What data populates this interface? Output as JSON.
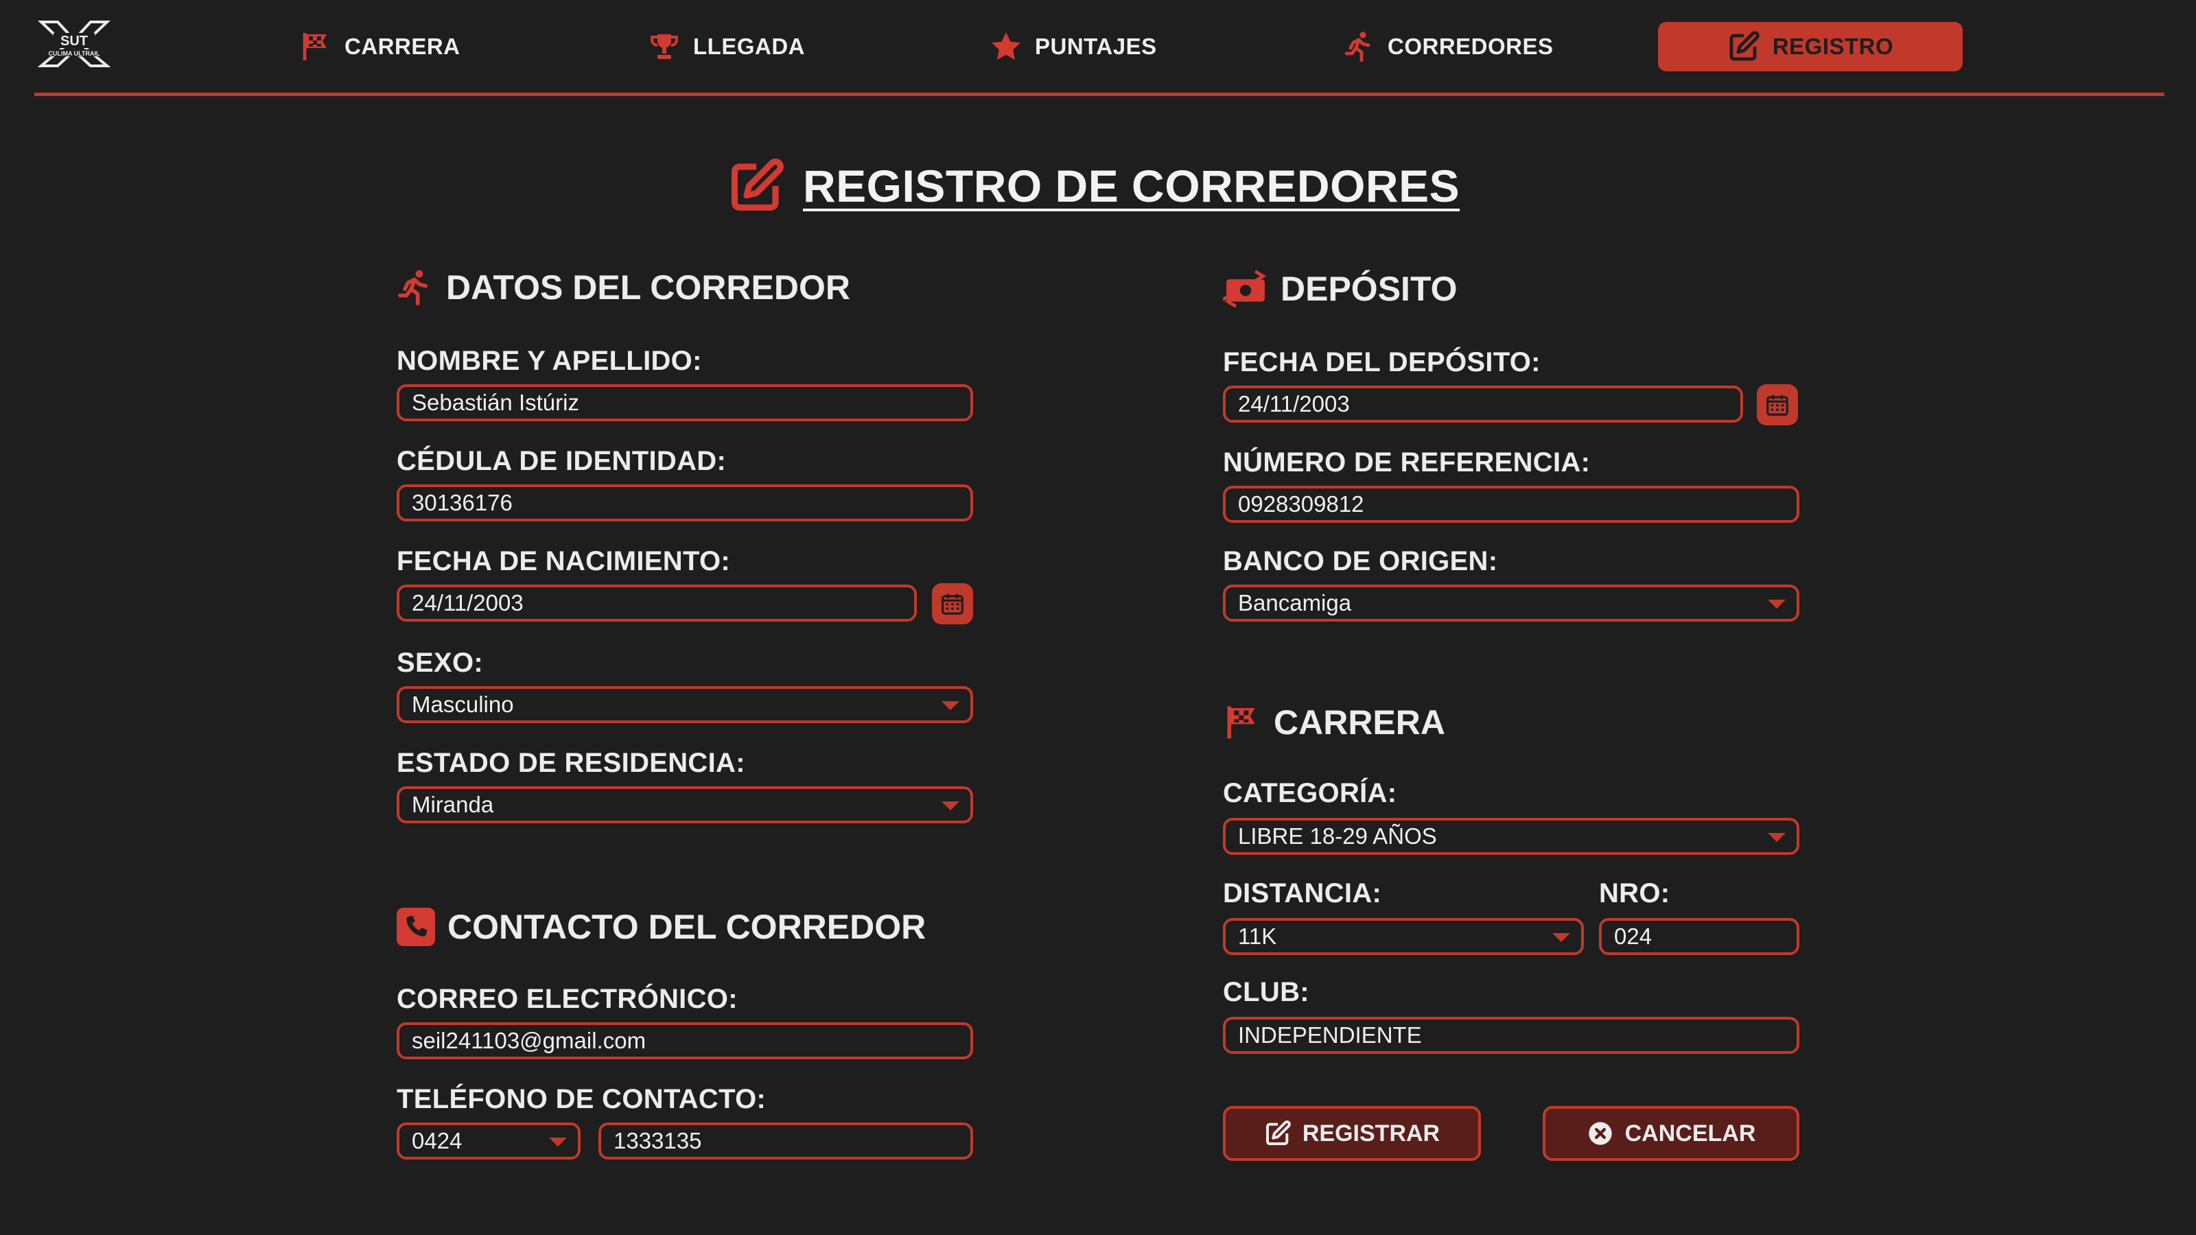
{
  "brand": {
    "logo_text_top": "SUT",
    "logo_text_bottom": "CULIMA ULTRAIL"
  },
  "nav": {
    "items": [
      {
        "label": "CARRERA",
        "icon": "checkered-flag-icon"
      },
      {
        "label": "LLEGADA",
        "icon": "trophy-icon"
      },
      {
        "label": "PUNTAJES",
        "icon": "star-icon"
      },
      {
        "label": "CORREDORES",
        "icon": "runner-icon"
      },
      {
        "label": "REGISTRO",
        "icon": "edit-icon",
        "active": true
      }
    ]
  },
  "page_title": "REGISTRO DE CORREDORES",
  "datos": {
    "heading": "DATOS DEL CORREDOR",
    "nombre_label": "NOMBRE Y APELLIDO:",
    "nombre_value": "Sebastián Istúriz",
    "cedula_label": "CÉDULA DE IDENTIDAD:",
    "cedula_value": "30136176",
    "nacimiento_label": "FECHA DE NACIMIENTO:",
    "nacimiento_value": "24/11/2003",
    "sexo_label": "SEXO:",
    "sexo_value": "Masculino",
    "estado_label": "ESTADO DE RESIDENCIA:",
    "estado_value": "Miranda"
  },
  "contacto": {
    "heading": "CONTACTO DEL CORREDOR",
    "correo_label": "CORREO ELECTRÓNICO:",
    "correo_value": "seil241103@gmail.com",
    "telefono_label": "TELÉFONO DE CONTACTO:",
    "telefono_prefix": "0424",
    "telefono_value": "1333135"
  },
  "deposito": {
    "heading": "DEPÓSITO",
    "fecha_label": "FECHA DEL DEPÓSITO:",
    "fecha_value": "24/11/2003",
    "referencia_label": "NÚMERO DE REFERENCIA:",
    "referencia_value": "0928309812",
    "banco_label": "BANCO DE ORIGEN:",
    "banco_value": "Bancamiga"
  },
  "carrera": {
    "heading": "CARRERA",
    "categoria_label": "CATEGORÍA:",
    "categoria_value": "LIBRE 18-29 AÑOS",
    "distancia_label": "DISTANCIA:",
    "distancia_value": "11K",
    "nro_label": "NRO:",
    "nro_value": "024",
    "club_label": "CLUB:",
    "club_value": "INDEPENDIENTE"
  },
  "actions": {
    "registrar_label": "REGISTRAR",
    "cancelar_label": "CANCELAR"
  },
  "colors": {
    "accent": "#c0392b",
    "background": "#1e1e1e",
    "button_bg": "#5a1e1a",
    "text": "#ececec"
  }
}
